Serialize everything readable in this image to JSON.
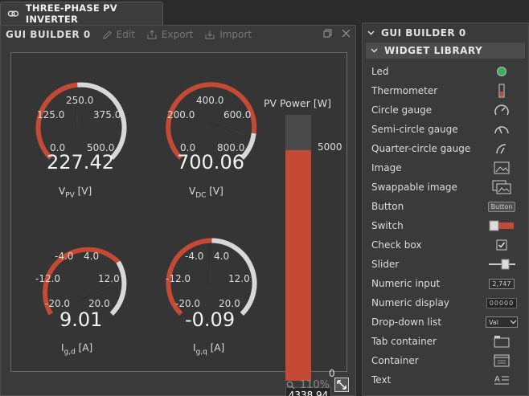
{
  "tab": {
    "title": "THREE-PHASE PV INVERTER"
  },
  "builder": {
    "title": "GUI BUILDER 0",
    "edit_label": "Edit",
    "export_label": "Export",
    "import_label": "Import",
    "zoom": "110%"
  },
  "gauges": [
    {
      "ticks": {
        "min": "0.0",
        "q1": "125.0",
        "mid": "250.0",
        "q3": "375.0",
        "max": "500.0"
      },
      "value": "227.42",
      "label_main": "V",
      "label_sub": "PV",
      "label_unit": " [V]"
    },
    {
      "ticks": {
        "min": "0.0",
        "q1": "200.0",
        "mid": "400.0",
        "q3": "600.0",
        "max": "800.0"
      },
      "value": "700.06",
      "label_main": "V",
      "label_sub": "DC",
      "label_unit": " [V]"
    },
    {
      "ticks": {
        "min": "-20.0",
        "q1": "-12.0",
        "mid": "-4.0",
        "q3": "4.0",
        "max": "12.0",
        "max2": "20.0"
      },
      "value": "9.01",
      "label_main": "I",
      "label_sub": "g,d",
      "label_unit": " [A]"
    },
    {
      "ticks": {
        "min": "-20.0",
        "q1": "-12.0",
        "mid": "-4.0",
        "q3": "4.0",
        "max": "12.0",
        "max2": "20.0"
      },
      "value": "-0.09",
      "label_main": "I",
      "label_sub": "g,q",
      "label_unit": " [A]"
    }
  ],
  "pv_power": {
    "title": "PV Power [W]",
    "max_label": "5000",
    "min_label": "0",
    "readout": "4338.94",
    "fraction": 0.8678
  },
  "library": {
    "header": "GUI BUILDER 0",
    "section": "WIDGET LIBRARY",
    "items": [
      {
        "label": "Led",
        "icon": "led-icon"
      },
      {
        "label": "Thermometer",
        "icon": "thermometer-icon"
      },
      {
        "label": "Circle gauge",
        "icon": "circle-gauge-icon"
      },
      {
        "label": "Semi-circle gauge",
        "icon": "semi-circle-gauge-icon"
      },
      {
        "label": "Quarter-circle gauge",
        "icon": "quarter-circle-gauge-icon"
      },
      {
        "label": "Image",
        "icon": "image-icon"
      },
      {
        "label": "Swappable image",
        "icon": "swappable-image-icon"
      },
      {
        "label": "Button",
        "icon": "button-icon",
        "icon_text": "Button"
      },
      {
        "label": "Switch",
        "icon": "switch-icon"
      },
      {
        "label": "Check box",
        "icon": "checkbox-icon"
      },
      {
        "label": "Slider",
        "icon": "slider-icon"
      },
      {
        "label": "Numeric input",
        "icon": "numeric-input-icon",
        "icon_text": "2,747"
      },
      {
        "label": "Numeric display",
        "icon": "numeric-display-icon",
        "icon_text": "00000"
      },
      {
        "label": "Drop-down list",
        "icon": "dropdown-icon",
        "icon_text": "Val"
      },
      {
        "label": "Tab container",
        "icon": "tab-container-icon"
      },
      {
        "label": "Container",
        "icon": "container-icon"
      },
      {
        "label": "Text",
        "icon": "text-icon"
      }
    ]
  },
  "colors": {
    "accent_red": "#c54a35",
    "arc_white": "#d8d8d8",
    "panel": "#3a3a3a"
  }
}
